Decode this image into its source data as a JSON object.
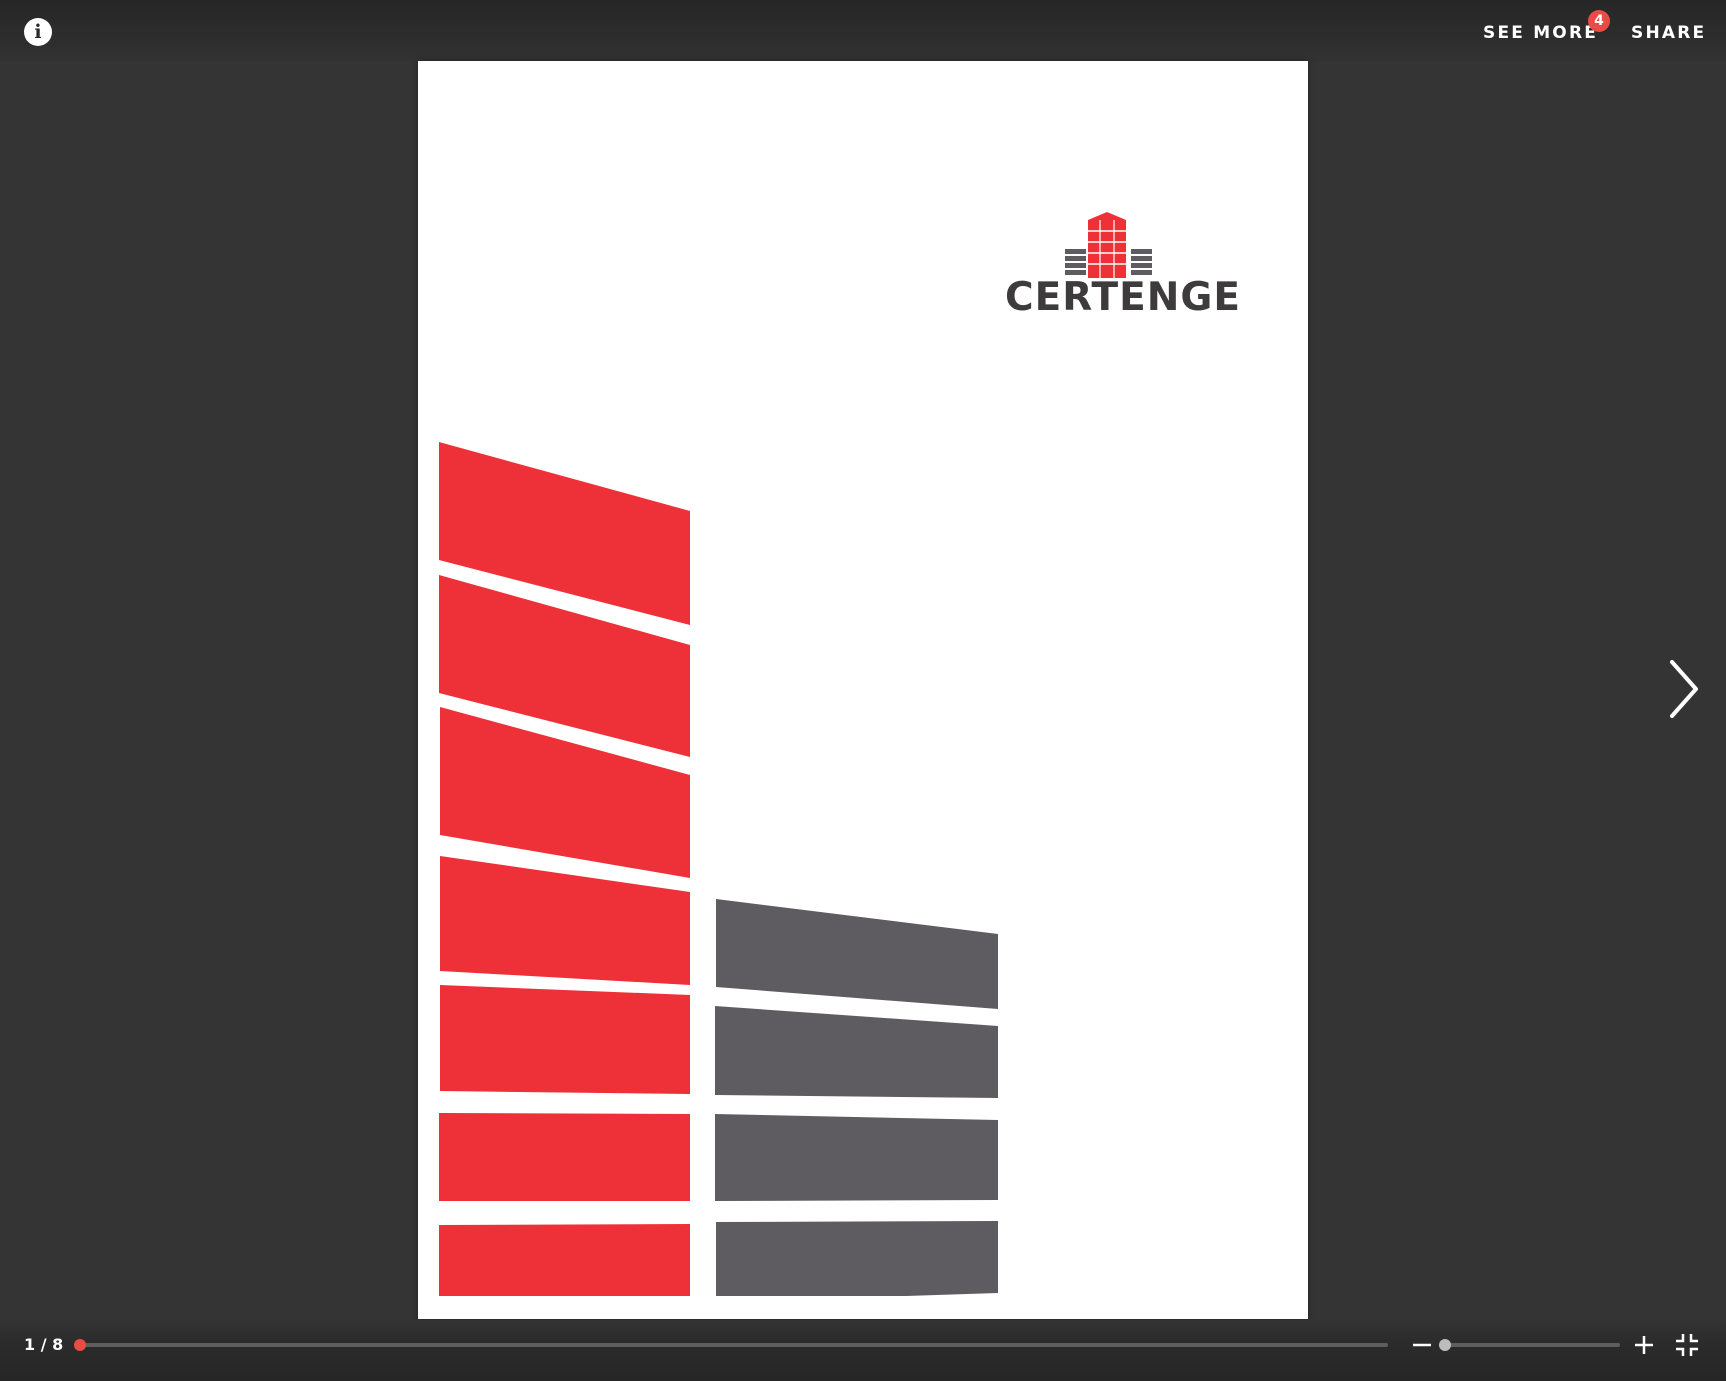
{
  "header": {
    "info_icon": "info-icon",
    "info_glyph": "i",
    "see_more_label": "SEE MORE",
    "see_more_badge": "4",
    "share_label": "SHARE"
  },
  "document": {
    "logo_text": "CERTENGE",
    "colors": {
      "red": "#EE3038",
      "dark": "#5E5C61",
      "logo_text": "#3D3B3C"
    }
  },
  "navigation": {
    "next_icon": "chevron-right-icon"
  },
  "footer": {
    "page_counter": "1 / 8",
    "current_page": 1,
    "total_pages": 8,
    "zoom_out_icon": "minus-icon",
    "zoom_in_icon": "plus-icon",
    "fullscreen_icon": "exit-fullscreen-icon",
    "accent_color": "#E84C45"
  }
}
